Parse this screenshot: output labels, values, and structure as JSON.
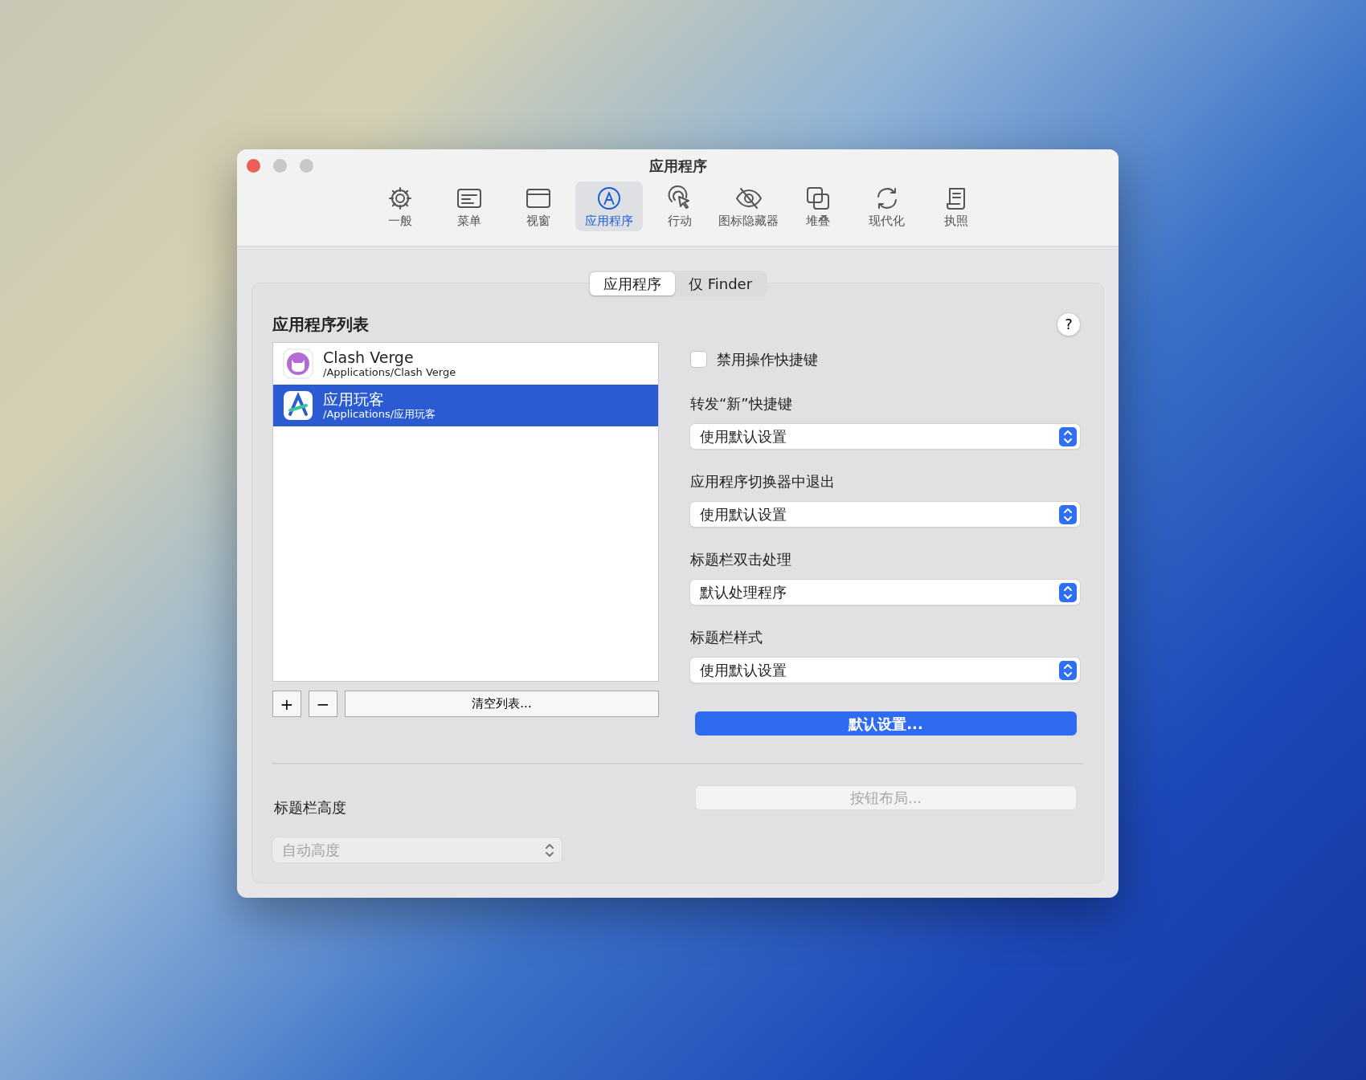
{
  "window": {
    "title": "应用程序"
  },
  "toolbar": [
    {
      "label": "一般",
      "kind": "gear",
      "selected": false
    },
    {
      "label": "菜单",
      "kind": "menu",
      "selected": false
    },
    {
      "label": "视窗",
      "kind": "window",
      "selected": false
    },
    {
      "label": "应用程序",
      "kind": "app",
      "selected": true
    },
    {
      "label": "行动",
      "kind": "pointer",
      "selected": false
    },
    {
      "label": "图标隐藏器",
      "kind": "eye",
      "selected": false
    },
    {
      "label": "堆叠",
      "kind": "stack",
      "selected": false
    },
    {
      "label": "现代化",
      "kind": "refresh",
      "selected": false
    },
    {
      "label": "执照",
      "kind": "scroll",
      "selected": false
    }
  ],
  "segments": [
    {
      "label": "应用程序",
      "selected": true
    },
    {
      "label": "仅 Finder",
      "selected": false
    }
  ],
  "help": "?",
  "app_list": {
    "title": "应用程序列表",
    "items": [
      {
        "name": "Clash Verge",
        "path": "/Applications/Clash Verge",
        "kind": "cat",
        "selected": false
      },
      {
        "name": "应用玩客",
        "path": "/Applications/应用玩客",
        "kind": "a",
        "selected": true
      }
    ]
  },
  "list_buttons": {
    "add": "+",
    "remove": "−",
    "clear": "清空列表..."
  },
  "disable_shortcuts": {
    "label": "禁用操作快捷键",
    "checked": false
  },
  "selects": [
    {
      "label": "转发“新”快捷键",
      "value": "使用默认设置"
    },
    {
      "label": "应用程序切换器中退出",
      "value": "使用默认设置"
    },
    {
      "label": "标题栏双击处理",
      "value": "默认处理程序"
    },
    {
      "label": "标题栏样式",
      "value": "使用默认设置"
    }
  ],
  "defaults_button": "默认设置...",
  "title_bar_height": {
    "label": "标题栏高度",
    "value": "自动高度",
    "disabled": true
  },
  "button_layout": {
    "label": "按钮布局...",
    "disabled": true
  }
}
